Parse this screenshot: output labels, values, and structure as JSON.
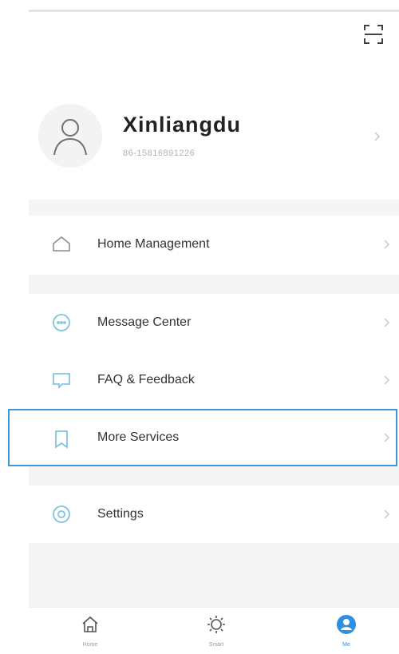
{
  "colors": {
    "accent": "#2f8fe0",
    "icon_gray": "#8a8a8a",
    "icon_teal": "#7fc6e0",
    "highlight_border": "#3a9ad9",
    "section_gap": "#f5f5f5"
  },
  "header": {
    "scan_icon": "scan-icon"
  },
  "profile": {
    "avatar_icon": "user-outline-icon",
    "name": "Xinliangdu",
    "phone": "86-15816891226"
  },
  "menu": {
    "home_management": {
      "label": "Home Management",
      "icon": "home-outline-icon"
    },
    "message_center": {
      "label": "Message Center",
      "icon": "message-icon"
    },
    "faq_feedback": {
      "label": "FAQ & Feedback",
      "icon": "feedback-icon"
    },
    "more_services": {
      "label": "More Services",
      "icon": "bookmark-icon"
    },
    "settings": {
      "label": "Settings",
      "icon": "settings-icon"
    }
  },
  "tabbar": {
    "tabs": [
      {
        "label": "Home",
        "icon": "home-icon",
        "active": false
      },
      {
        "label": "Smart",
        "icon": "sun-icon",
        "active": false
      },
      {
        "label": "Me",
        "icon": "person-filled-icon",
        "active": true
      }
    ]
  }
}
